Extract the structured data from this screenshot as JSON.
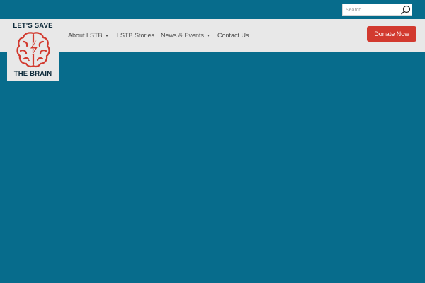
{
  "search": {
    "placeholder": "Search",
    "icon": "search-icon"
  },
  "logo": {
    "line1": "LET'S SAVE",
    "line2": "THE BRAIN",
    "icon": "brain-icon",
    "color": "#d23a2f"
  },
  "nav": {
    "items": [
      {
        "label": "About LSTB",
        "dropdown": true
      },
      {
        "label": "LSTB Stories",
        "dropdown": false
      },
      {
        "label": "News & Events",
        "dropdown": true
      },
      {
        "label": "Contact Us",
        "dropdown": false
      }
    ]
  },
  "cta": {
    "label": "Donate Now",
    "color": "#d23a2f"
  },
  "theme": {
    "background": "#076c8c",
    "navbar": "#e8e8e8"
  }
}
